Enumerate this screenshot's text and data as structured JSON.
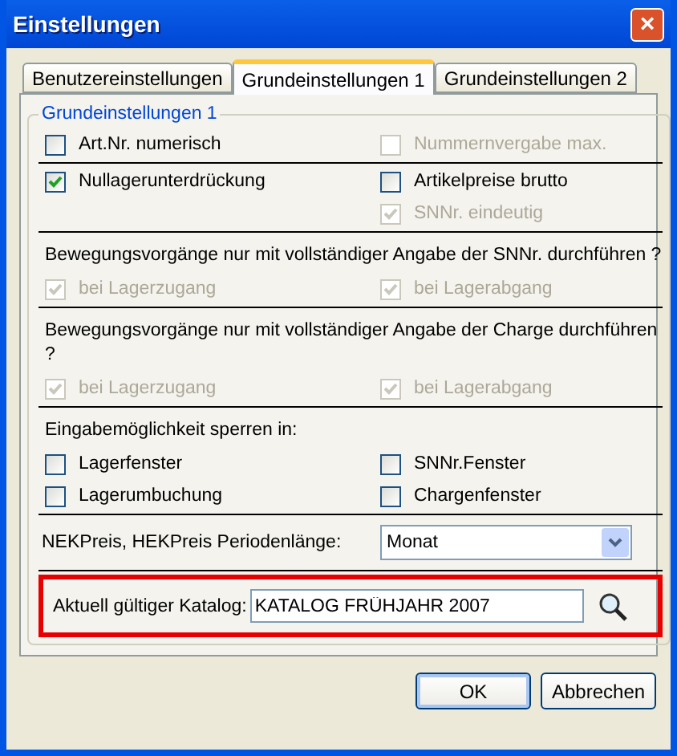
{
  "window": {
    "title": "Einstellungen",
    "close": "×"
  },
  "tabs": [
    {
      "label": "Benutzereinstellungen",
      "selected": false
    },
    {
      "label": "Grundeinstellungen 1",
      "selected": true
    },
    {
      "label": "Grundeinstellungen 2",
      "selected": false
    }
  ],
  "group": {
    "legend": "Grundeinstellungen 1",
    "sections": [
      {
        "left": [
          {
            "label": "Art.Nr. numerisch",
            "checked": false,
            "disabled": false
          }
        ],
        "right": [
          {
            "label": "Nummernvergabe max.",
            "checked": false,
            "disabled": true
          }
        ]
      },
      {
        "left": [
          {
            "label": "Nullagerunterdrückung",
            "checked": true,
            "disabled": false
          }
        ],
        "right": [
          {
            "label": "Artikelpreise brutto",
            "checked": false,
            "disabled": false
          },
          {
            "label": "SNNr. eindeutig",
            "checked": true,
            "disabled": true
          }
        ]
      },
      {
        "heading": "Bewegungsvorgänge nur mit vollständiger Angabe der SNNr. durchführen ?",
        "left": [
          {
            "label": "bei Lagerzugang",
            "checked": true,
            "disabled": true
          }
        ],
        "right": [
          {
            "label": "bei Lagerabgang",
            "checked": true,
            "disabled": true
          }
        ]
      },
      {
        "heading": "Bewegungsvorgänge nur mit vollständiger Angabe der Charge durchführen ?",
        "left": [
          {
            "label": "bei Lagerzugang",
            "checked": true,
            "disabled": true
          }
        ],
        "right": [
          {
            "label": "bei Lagerabgang",
            "checked": true,
            "disabled": true
          }
        ]
      },
      {
        "heading": "Eingabemöglichkeit sperren in:",
        "left": [
          {
            "label": "Lagerfenster",
            "checked": false,
            "disabled": false
          },
          {
            "label": "Lagerumbuchung",
            "checked": false,
            "disabled": false
          }
        ],
        "right": [
          {
            "label": "SNNr.Fenster",
            "checked": false,
            "disabled": false
          },
          {
            "label": "Chargenfenster",
            "checked": false,
            "disabled": false
          }
        ]
      }
    ],
    "period": {
      "label": "NEKPreis, HEKPreis Periodenlänge:",
      "value": "Monat"
    },
    "catalog": {
      "label": "Aktuell gültiger Katalog:",
      "value": "KATALOG FRÜHJAHR 2007",
      "highlighted": true
    }
  },
  "buttons": [
    {
      "label": "OK",
      "default": true
    },
    {
      "label": "Abbrechen",
      "default": false
    }
  ]
}
